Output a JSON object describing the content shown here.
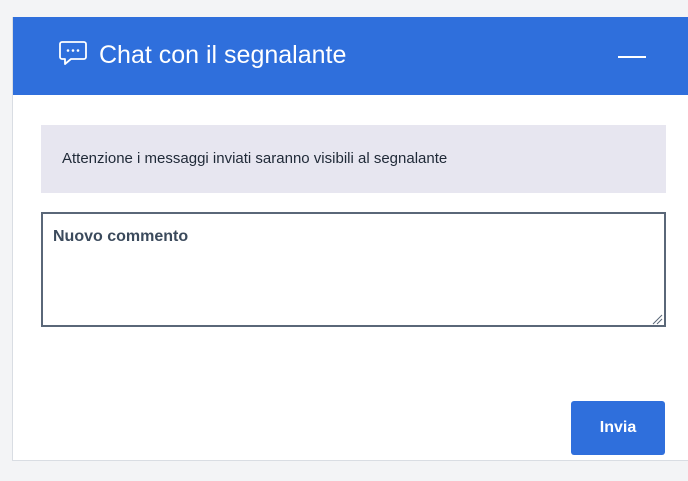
{
  "header": {
    "icon": "chat-bubble-icon",
    "title": "Chat con il segnalante",
    "collapse_icon": "minimize-icon"
  },
  "notice": {
    "text": "Attenzione i messaggi inviati saranno visibili al segnalante"
  },
  "comment": {
    "placeholder": "Nuovo commento",
    "value": ""
  },
  "actions": {
    "send_label": "Invia"
  },
  "colors": {
    "accent": "#2f6fdc",
    "notice_background": "#e7e6f0",
    "field_border": "#5a6778"
  }
}
